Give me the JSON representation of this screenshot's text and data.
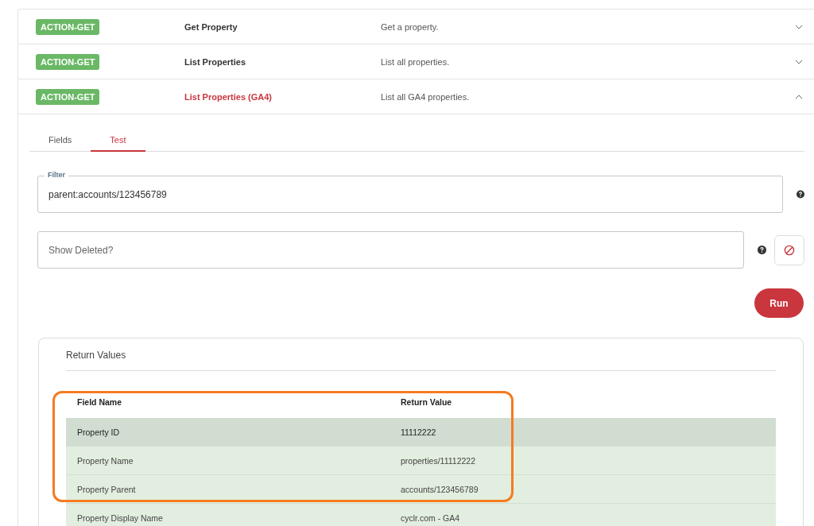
{
  "actions": [
    {
      "badge": "ACTION-GET",
      "name": "Get Property",
      "description": "Get a property.",
      "expanded": false
    },
    {
      "badge": "ACTION-GET",
      "name": "List Properties",
      "description": "List all properties.",
      "expanded": false
    },
    {
      "badge": "ACTION-GET",
      "name": "List Properties (GA4)",
      "description": "List all GA4 properties.",
      "expanded": true
    }
  ],
  "tabs": [
    {
      "label": "Fields",
      "selected": false
    },
    {
      "label": "Test",
      "selected": true
    }
  ],
  "filter": {
    "label": "Filter",
    "value": "parent:accounts/123456789"
  },
  "show_deleted": {
    "placeholder": "Show Deleted?"
  },
  "run_button": "Run",
  "return_values": {
    "title": "Return Values",
    "columns": [
      "Field Name",
      "Return Value"
    ],
    "rows": [
      {
        "field": "Property ID",
        "value": "11112222",
        "selected": true
      },
      {
        "field": "Property Name",
        "value": "properties/11112222",
        "selected": false
      },
      {
        "field": "Property Parent",
        "value": "accounts/123456789",
        "selected": false
      },
      {
        "field": "Property Display Name",
        "value": "cyclr.com - GA4",
        "selected": false
      }
    ]
  }
}
